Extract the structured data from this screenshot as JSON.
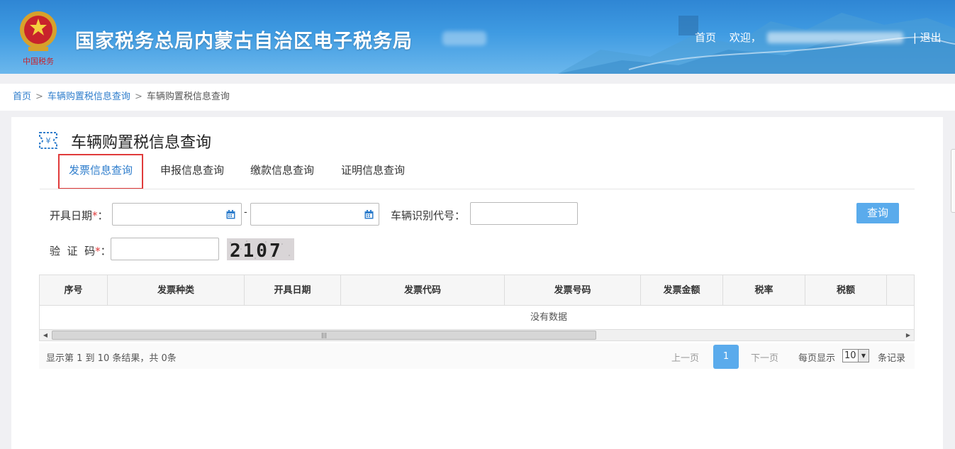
{
  "header": {
    "site_title": "国家税务总局内蒙古自治区电子税务局",
    "nav_home": "首页",
    "nav_welcome": "欢迎，",
    "nav_logout": "| 退出",
    "emblem_text": "中国税务"
  },
  "breadcrumb": {
    "home": "首页",
    "sep": ">",
    "level1": "车辆购置税信息查询",
    "current": "车辆购置税信息查询"
  },
  "page": {
    "heading": "车辆购置税信息查询",
    "icon": "yuan-ticket-icon"
  },
  "tabs": [
    {
      "label": "发票信息查询",
      "active": true
    },
    {
      "label": "申报信息查询",
      "active": false
    },
    {
      "label": "缴款信息查询",
      "active": false
    },
    {
      "label": "证明信息查询",
      "active": false
    }
  ],
  "form": {
    "date_label": "开具日期",
    "required_mark": "*",
    "colon": "：",
    "date_sep": "-",
    "date_from_value": "",
    "date_to_value": "",
    "vin_label": "车辆识别代号：",
    "vin_value": "",
    "captcha_label": "验  证  码",
    "captcha_value": "",
    "captcha_text": "2107",
    "query_button": "查询"
  },
  "table": {
    "columns": [
      "序号",
      "发票种类",
      "开具日期",
      "发票代码",
      "发票号码",
      "发票金额",
      "税率",
      "税额"
    ],
    "empty_text": "没有数据"
  },
  "pager": {
    "info": "显示第 1 到 10 条结果，共 0条",
    "prev": "上一页",
    "current_page": "1",
    "next": "下一页",
    "per_page_label": "每页显示",
    "per_page_value": "10",
    "records_label": "条记录"
  },
  "colors": {
    "accent": "#2e7dcc",
    "button": "#5aabec",
    "active_tab_border": "#e03b3b"
  }
}
